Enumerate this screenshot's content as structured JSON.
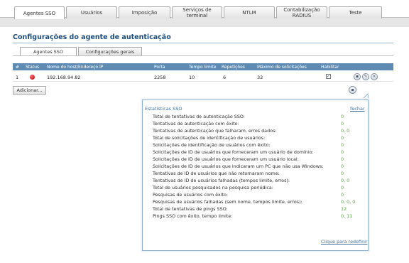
{
  "tabs": [
    {
      "label": "Agentes SSO"
    },
    {
      "label": "Usuários"
    },
    {
      "label": "Imposição"
    },
    {
      "label": "Serviços de terminal"
    },
    {
      "label": "NTLM"
    },
    {
      "label": "Contabilização RADIUS"
    },
    {
      "label": "Teste"
    }
  ],
  "page": {
    "title": "Configurações do agente de autenticação"
  },
  "subtabs": [
    {
      "label": "Agentes SSO"
    },
    {
      "label": "Configurações gerais"
    }
  ],
  "table": {
    "headers": {
      "num": "#",
      "status": "Status",
      "host": "Nome do host/Endereço IP",
      "port": "Porta",
      "timeout": "Tempo limite",
      "retries": "Repetições",
      "max_requests": "Máximo de solicitações",
      "enable": "Habilitar"
    },
    "rows": [
      {
        "num": "1",
        "status": "red",
        "host": "192.168.94.82",
        "port": "2258",
        "timeout": "10",
        "retries": "6",
        "max_requests": "32",
        "enabled": "✓"
      }
    ]
  },
  "actions": {
    "add": "Adicionar..."
  },
  "stats_popup": {
    "title": "Estatísticas SSO",
    "close": "fechar",
    "reset": "Clique para redefinir",
    "rows": [
      {
        "label": "Total de tentativas de autenticação SSO:",
        "value": "0"
      },
      {
        "label": "Tentativas de autenticação com êxito:",
        "value": "0"
      },
      {
        "label": "Tentativas de autenticação que falharam, erros dados:",
        "value": "0, 0"
      },
      {
        "label": "Total de solicitações de identificação de usuários:",
        "value": "0"
      },
      {
        "label": "Solicitações de identificação de usuários com êxito:",
        "value": "0"
      },
      {
        "label": "Solicitações de ID de usuários que forneceram um usuário de domínio:",
        "value": "0"
      },
      {
        "label": "Solicitações de ID de usuários que forneceram um usuário local:",
        "value": "0"
      },
      {
        "label": "Solicitações de ID de usuários que indicaram um PC que não usa Windows:",
        "value": "0"
      },
      {
        "label": "Tentativas de ID de usuários que não retornaram nome:",
        "value": "0"
      },
      {
        "label": "Tentativas de ID de usuários falhadas (tempos limite, erros):",
        "value": "0, 0"
      },
      {
        "label": "Total de usuários pesquisados na pesquisa periódica:",
        "value": "0"
      },
      {
        "label": "Pesquisas de usuários com êxito:",
        "value": "0"
      },
      {
        "label": "Pesquisas de usuários falhadas (sem nome, tempos limite, erros):",
        "value": "0, 0, 0"
      },
      {
        "label": "Total de tentativas de pings SSO:",
        "value": "12"
      },
      {
        "label": "Pings SSO com êxito, tempo limite:",
        "value": "0, 11"
      }
    ]
  }
}
